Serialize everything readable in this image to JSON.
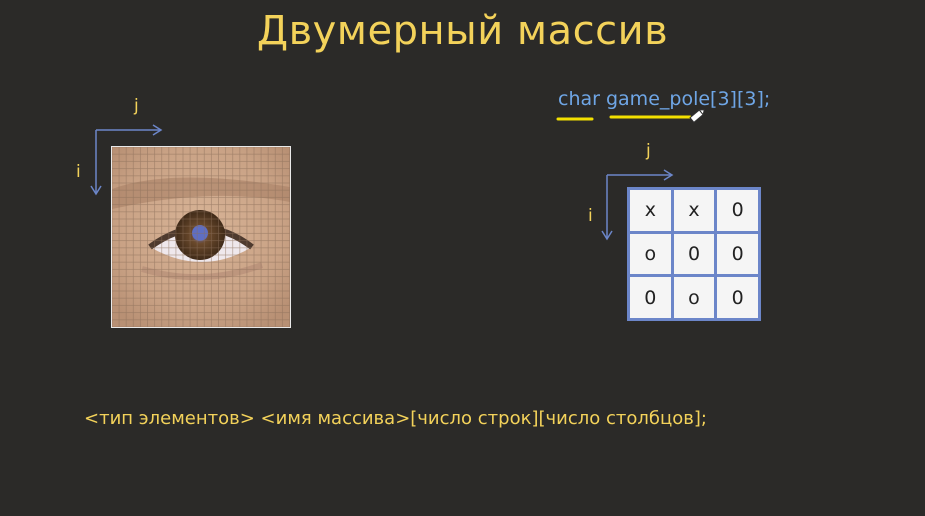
{
  "slide": {
    "title": "Двумерный массив",
    "code_declaration": "char game_pole[3][3];",
    "syntax_line": "<тип элементов> <имя массива>[число строк][число столбцов];"
  },
  "image_axes": {
    "row_label": "i",
    "col_label": "j"
  },
  "grid_axes": {
    "row_label": "i",
    "col_label": "j"
  },
  "game_grid": {
    "rows": [
      [
        "x",
        "x",
        "0"
      ],
      [
        "o",
        "0",
        "0"
      ],
      [
        "0",
        "o",
        "0"
      ]
    ]
  },
  "colors": {
    "background": "#2b2a28",
    "title": "#f3d25a",
    "code": "#6fa6e6",
    "axis": "#6c86c9",
    "underline": "#f3e000"
  },
  "icons": {
    "cursor": "pen-cursor-icon"
  }
}
